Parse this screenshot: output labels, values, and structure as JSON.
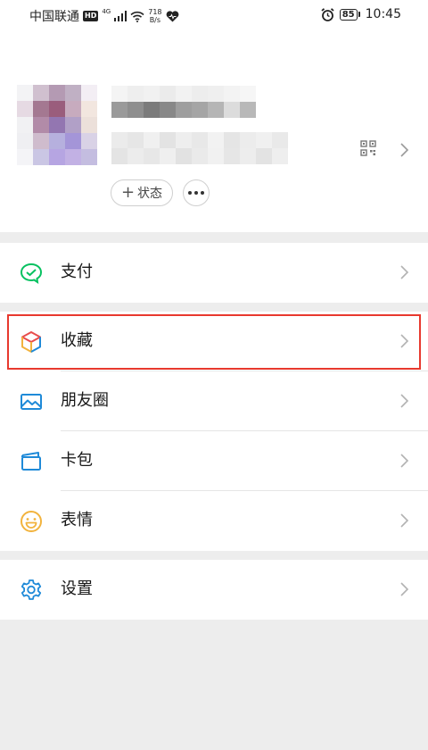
{
  "status_bar": {
    "carrier": "中国联通",
    "hd": "HD",
    "network_gen": "4G",
    "speed_value": "718",
    "speed_unit": "B/s",
    "battery": "85",
    "time": "10:45"
  },
  "profile": {
    "status_button_label": "状态",
    "status_button_prefix": "+"
  },
  "menu": {
    "pay": "支付",
    "favorites": "收藏",
    "moments": "朋友圈",
    "cards": "卡包",
    "stickers": "表情",
    "settings": "设置"
  },
  "colors": {
    "highlight": "#e8392e",
    "pay_green": "#07c160",
    "blue_icon": "#1f8ad8",
    "sticker_yellow": "#f2b33d"
  }
}
